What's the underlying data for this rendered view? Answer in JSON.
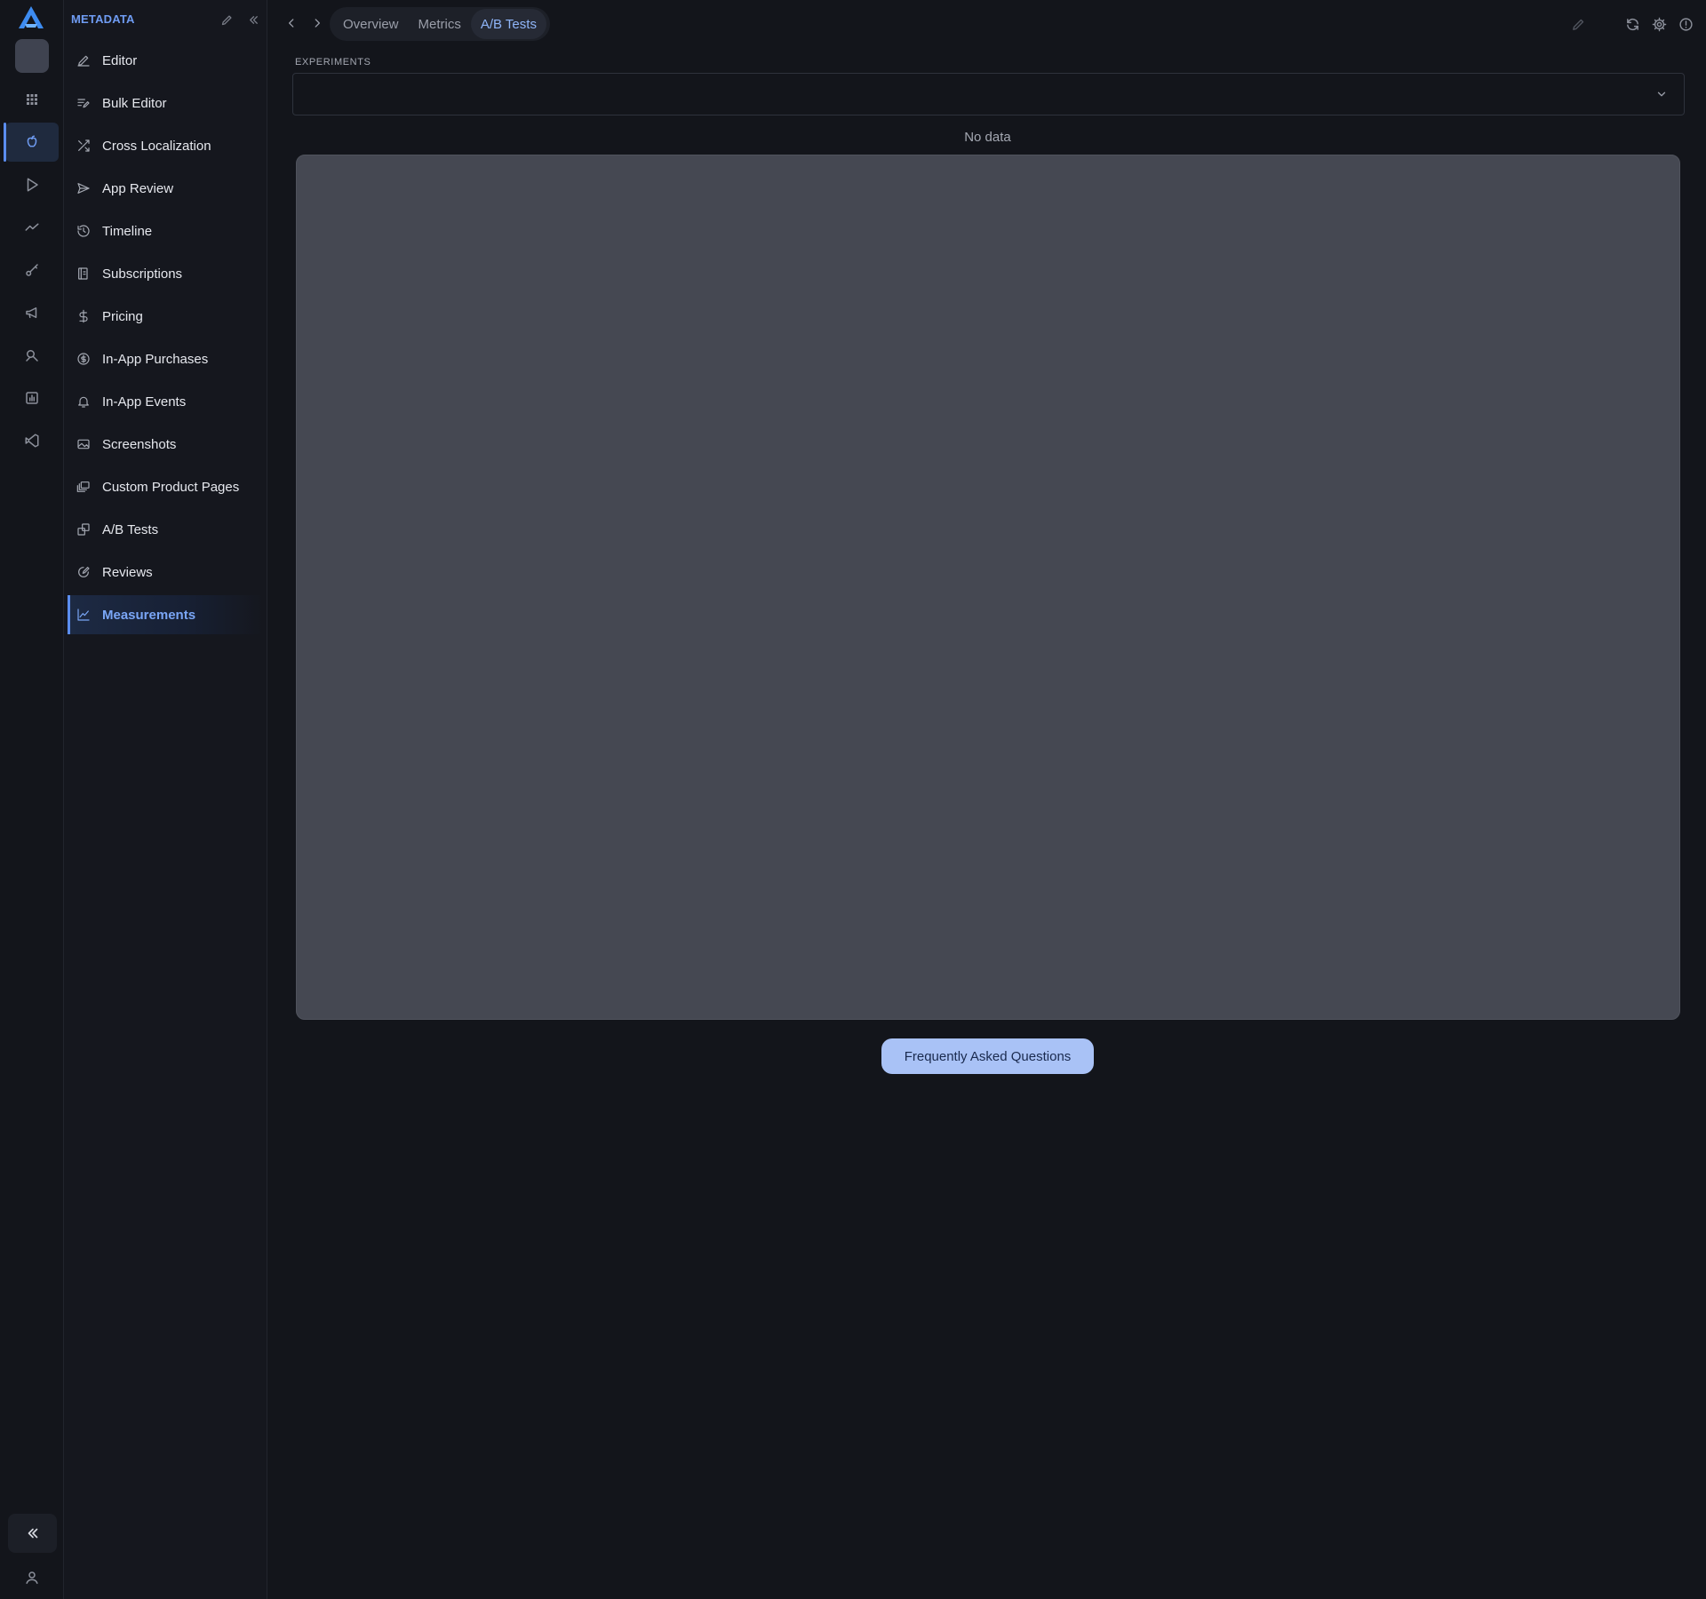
{
  "app": {
    "accent_color": "#5b8def",
    "background_color": "#13151b"
  },
  "rail": {
    "logo_icon": "a-logo-icon",
    "items": [
      {
        "icon": "grid-icon"
      },
      {
        "icon": "apple-icon",
        "active": true
      },
      {
        "icon": "play-store-icon"
      },
      {
        "icon": "trend-line-icon"
      },
      {
        "icon": "key-icon"
      },
      {
        "icon": "megaphone-icon"
      },
      {
        "icon": "search-tools-icon"
      },
      {
        "icon": "bar-chart-icon"
      },
      {
        "icon": "vscode-icon"
      }
    ],
    "collapse_icon": "double-chevron-left-icon",
    "user_icon": "user-icon"
  },
  "panel": {
    "title": "METADATA",
    "items": [
      {
        "label": "Editor",
        "icon": "pencil-icon"
      },
      {
        "label": "Bulk Editor",
        "icon": "bulk-edit-icon"
      },
      {
        "label": "Cross Localization",
        "icon": "shuffle-icon"
      },
      {
        "label": "App Review",
        "icon": "send-icon"
      },
      {
        "label": "Timeline",
        "icon": "history-icon"
      },
      {
        "label": "Subscriptions",
        "icon": "subscription-icon"
      },
      {
        "label": "Pricing",
        "icon": "dollar-icon"
      },
      {
        "label": "In-App Purchases",
        "icon": "coin-icon"
      },
      {
        "label": "In-App Events",
        "icon": "bell-icon"
      },
      {
        "label": "Screenshots",
        "icon": "image-icon"
      },
      {
        "label": "Custom Product Pages",
        "icon": "layers-icon"
      },
      {
        "label": "A/B Tests",
        "icon": "copy-icon"
      },
      {
        "label": "Reviews",
        "icon": "review-icon"
      },
      {
        "label": "Measurements",
        "icon": "line-chart-icon",
        "active": true
      }
    ]
  },
  "topbar": {
    "tabs": [
      {
        "label": "Overview"
      },
      {
        "label": "Metrics"
      },
      {
        "label": "A/B Tests",
        "active": true
      }
    ]
  },
  "content": {
    "experiments_label": "EXPERIMENTS",
    "experiments_value": "",
    "no_data_text": "No data",
    "faq_button": "Frequently Asked Questions"
  }
}
